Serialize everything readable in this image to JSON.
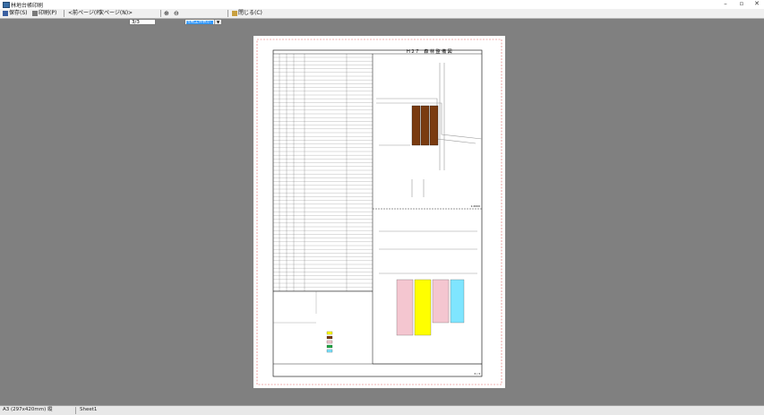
{
  "window": {
    "title": "林地台帳印刷"
  },
  "toolbar": {
    "save_label": "保存(S)",
    "print_label": "印刷(P)",
    "prev_label": "<前ページ(P)",
    "next_label": "次ページ(N)>",
    "page_value": "3/3",
    "zoom_value": "用紙全体表示",
    "close_label": "閉じる(C)"
  },
  "status": {
    "paper": "A3 (297x420mm) 縦",
    "sheet": "Sheet1"
  },
  "sheet": {
    "title": "Ｈ２７　森 林 整 備 図",
    "scale": "1:2000",
    "page": "3 / 3"
  },
  "colors": {
    "pink": "#f4c6d0",
    "yellow": "#ffff00",
    "cyan": "#7fe5ff",
    "brown": "#7a3b10",
    "green": "#22aa44"
  }
}
